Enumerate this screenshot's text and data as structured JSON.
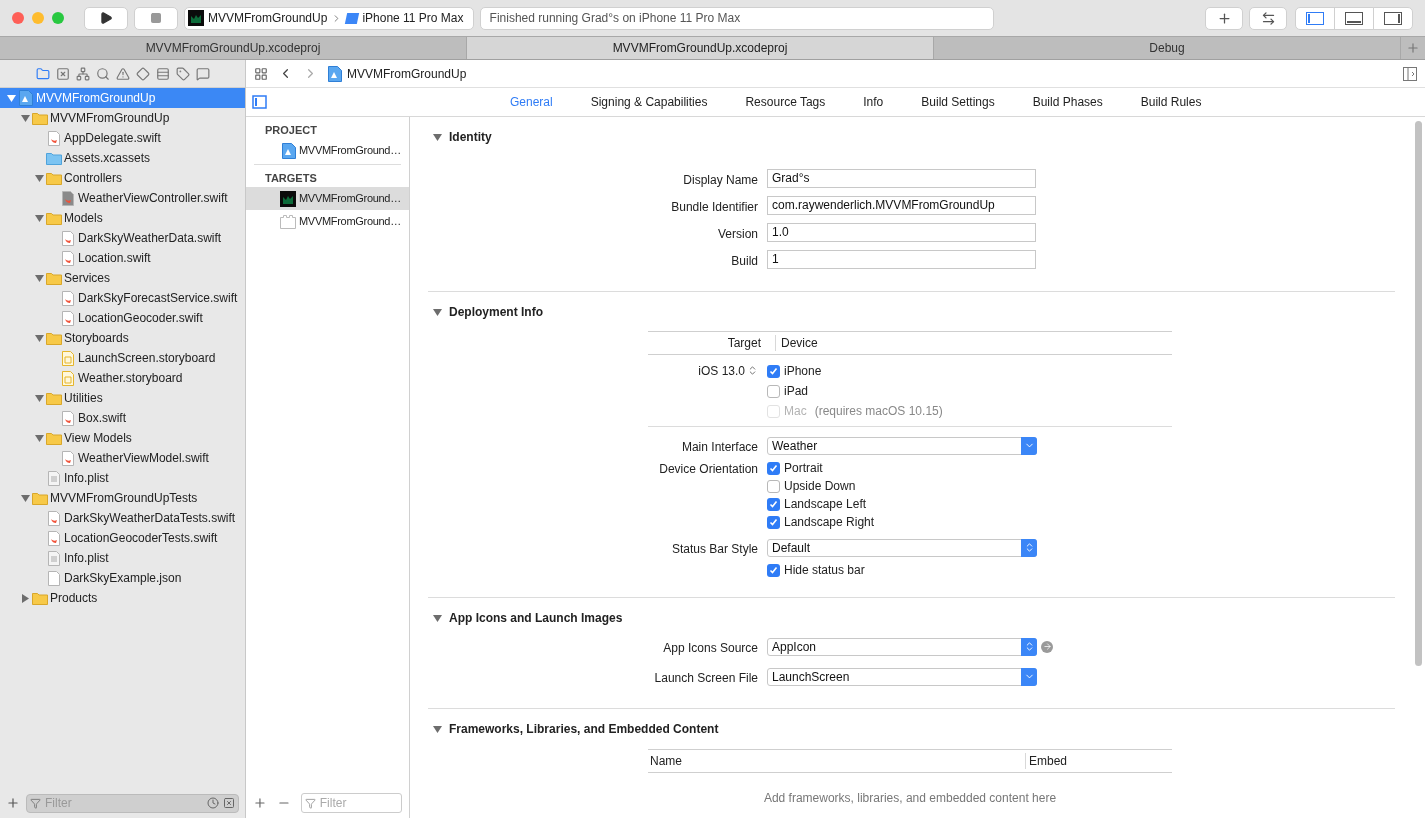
{
  "toolbar": {
    "scheme": "MVVMFromGroundUp",
    "device": "iPhone 11 Pro Max",
    "status": "Finished running Grad°s on iPhone 11 Pro Max",
    "layout_buttons": [
      {
        "kind": "navigator",
        "selected": true
      },
      {
        "kind": "debug",
        "selected": false
      },
      {
        "kind": "inspector",
        "selected": false
      }
    ]
  },
  "tabs": [
    {
      "label": "MVVMFromGroundUp.xcodeproj",
      "selected": false
    },
    {
      "label": "MVVMFromGroundUp.xcodeproj",
      "selected": true
    },
    {
      "label": "Debug",
      "selected": false
    }
  ],
  "navigator": {
    "tree": {
      "name": "MVVMFromGroundUp",
      "kind": "project",
      "selected": true,
      "expanded": true,
      "children": [
        {
          "name": "MVVMFromGroundUp",
          "kind": "folder",
          "selected": false,
          "expanded": true,
          "children": [
            {
              "name": "AppDelegate.swift",
              "kind": "swift",
              "selected": false
            },
            {
              "name": "Assets.xcassets",
              "kind": "assets",
              "selected": false
            },
            {
              "name": "Controllers",
              "kind": "folder",
              "selected": false,
              "expanded": true,
              "children": [
                {
                  "name": "WeatherViewController.swift",
                  "kind": "swift_gray",
                  "selected": false
                }
              ]
            },
            {
              "name": "Models",
              "kind": "folder",
              "selected": false,
              "expanded": true,
              "children": [
                {
                  "name": "DarkSkyWeatherData.swift",
                  "kind": "swift",
                  "selected": false
                },
                {
                  "name": "Location.swift",
                  "kind": "swift",
                  "selected": false
                }
              ]
            },
            {
              "name": "Services",
              "kind": "folder",
              "selected": false,
              "expanded": true,
              "children": [
                {
                  "name": "DarkSkyForecastService.swift",
                  "kind": "swift",
                  "selected": false
                },
                {
                  "name": "LocationGeocoder.swift",
                  "kind": "swift",
                  "selected": false
                }
              ]
            },
            {
              "name": "Storyboards",
              "kind": "folder",
              "selected": false,
              "expanded": true,
              "children": [
                {
                  "name": "LaunchScreen.storyboard",
                  "kind": "storyboard",
                  "selected": false
                },
                {
                  "name": "Weather.storyboard",
                  "kind": "storyboard",
                  "selected": false
                }
              ]
            },
            {
              "name": "Utilities",
              "kind": "folder",
              "selected": false,
              "expanded": true,
              "children": [
                {
                  "name": "Box.swift",
                  "kind": "swift",
                  "selected": false
                }
              ]
            },
            {
              "name": "View Models",
              "kind": "folder",
              "selected": false,
              "expanded": true,
              "children": [
                {
                  "name": "WeatherViewModel.swift",
                  "kind": "swift",
                  "selected": false
                }
              ]
            },
            {
              "name": "Info.plist",
              "kind": "plist",
              "selected": false
            }
          ]
        },
        {
          "name": "MVVMFromGroundUpTests",
          "kind": "folder",
          "selected": false,
          "expanded": true,
          "children": [
            {
              "name": "DarkSkyWeatherDataTests.swift",
              "kind": "swift",
              "selected": false
            },
            {
              "name": "LocationGeocoderTests.swift",
              "kind": "swift",
              "selected": false
            },
            {
              "name": "Info.plist",
              "kind": "plist",
              "selected": false
            },
            {
              "name": "DarkSkyExample.json",
              "kind": "json",
              "selected": false
            }
          ]
        },
        {
          "name": "Products",
          "kind": "folder",
          "selected": false,
          "expanded": false
        }
      ]
    },
    "filter_placeholder": "Filter"
  },
  "editor": {
    "breadcrumb": "MVVMFromGroundUp",
    "tabs": [
      {
        "label": "General",
        "selected": true
      },
      {
        "label": "Signing & Capabilities",
        "selected": false
      },
      {
        "label": "Resource Tags",
        "selected": false
      },
      {
        "label": "Info",
        "selected": false
      },
      {
        "label": "Build Settings",
        "selected": false
      },
      {
        "label": "Build Phases",
        "selected": false
      },
      {
        "label": "Build Rules",
        "selected": false
      }
    ],
    "project_header": "PROJECT",
    "projects": [
      {
        "name": "MVVMFromGround…",
        "kind": "project",
        "selected": false
      }
    ],
    "targets_header": "TARGETS",
    "targets": [
      {
        "name": "MVVMFromGround…",
        "kind": "app",
        "selected": true
      },
      {
        "name": "MVVMFromGround…",
        "kind": "test",
        "selected": false
      }
    ],
    "filter_placeholder": "Filter",
    "sections": [
      {
        "title": "Identity",
        "expanded": true,
        "rows": [
          {
            "kind": "text",
            "label": "Display Name",
            "value": "Grad°s"
          },
          {
            "kind": "text",
            "label": "Bundle Identifier",
            "value": "com.raywenderlich.MVVMFromGroundUp"
          },
          {
            "kind": "text",
            "label": "Version",
            "value": "1.0"
          },
          {
            "kind": "text",
            "label": "Build",
            "value": "1"
          }
        ]
      },
      {
        "title": "Deployment Info",
        "expanded": true,
        "rows": [
          {
            "kind": "pair_header",
            "columns": [
              "Target",
              "Device"
            ]
          },
          {
            "kind": "checks",
            "label": "iOS 13.0",
            "stepper": true,
            "options": [
              {
                "label": "iPhone",
                "checked": true,
                "disabled": false
              },
              {
                "label": "iPad",
                "checked": false,
                "disabled": false
              },
              {
                "label": "Mac",
                "note": "(requires macOS 10.15)",
                "checked": false,
                "disabled": true
              }
            ]
          },
          {
            "kind": "divider"
          },
          {
            "kind": "popup",
            "label": "Main Interface",
            "value": "Weather"
          },
          {
            "kind": "checks",
            "label": "Device Orientation",
            "options": [
              {
                "label": "Portrait",
                "checked": true,
                "disabled": false
              },
              {
                "label": "Upside Down",
                "checked": false,
                "disabled": false
              },
              {
                "label": "Landscape Left",
                "checked": true,
                "disabled": false
              },
              {
                "label": "Landscape Right",
                "checked": true,
                "disabled": false
              }
            ]
          },
          {
            "kind": "updown_popup",
            "label": "Status Bar Style",
            "value": "Default"
          },
          {
            "kind": "checks",
            "options": [
              {
                "label": "Hide status bar",
                "checked": true,
                "disabled": false
              }
            ]
          }
        ]
      },
      {
        "title": "App Icons and Launch Images",
        "expanded": true,
        "rows": [
          {
            "kind": "updown_popup",
            "label": "App Icons Source",
            "value": "AppIcon",
            "link": true
          },
          {
            "kind": "popup",
            "label": "Launch Screen File",
            "value": "LaunchScreen"
          }
        ]
      },
      {
        "title": "Frameworks, Libraries, and Embedded Content",
        "expanded": true,
        "rows": [
          {
            "kind": "table_header",
            "columns": [
              "Name",
              "Embed"
            ]
          },
          {
            "kind": "note",
            "text": "Add frameworks, libraries, and embedded content here"
          }
        ]
      }
    ]
  }
}
